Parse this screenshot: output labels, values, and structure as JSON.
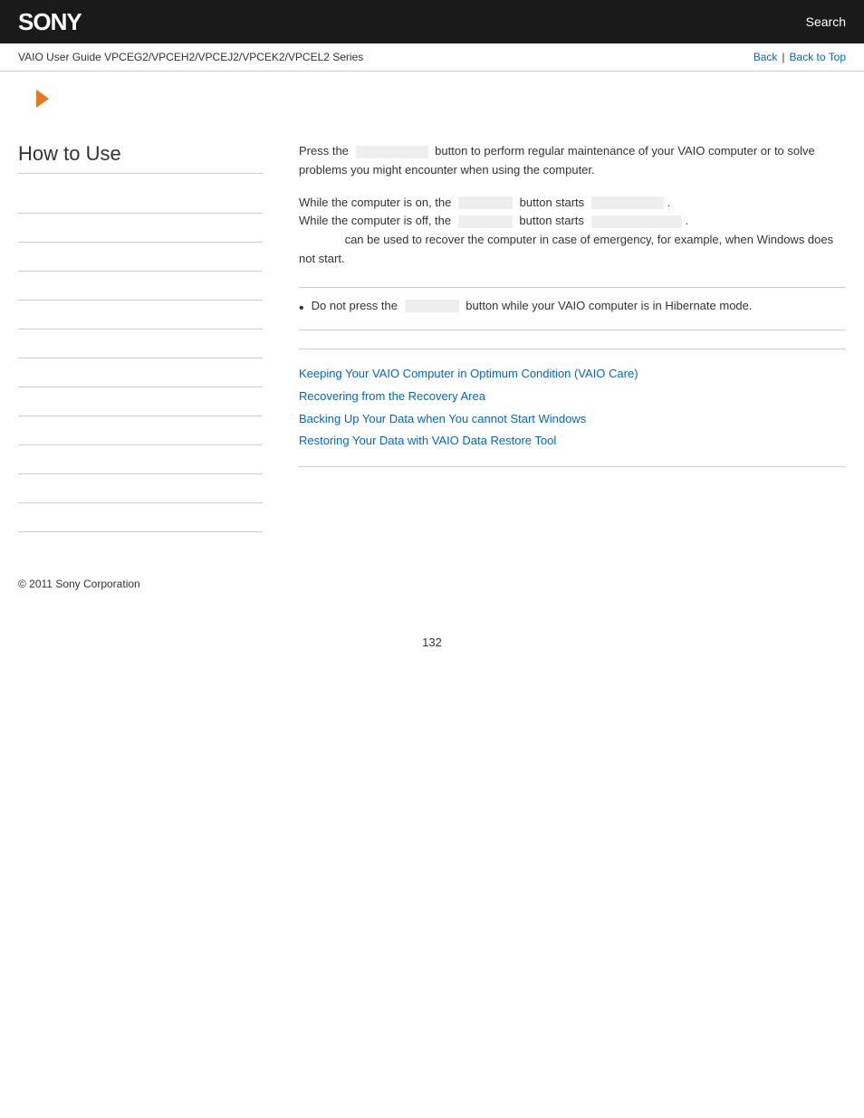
{
  "header": {
    "logo": "SONY",
    "search_label": "Search"
  },
  "nav": {
    "title": "VAIO User Guide VPCEG2/VPCEH2/VPCEJ2/VPCEK2/VPCEL2 Series",
    "back_link": "Back",
    "back_to_top_link": "Back to Top",
    "separator": "|"
  },
  "sidebar": {
    "title": "How to Use",
    "items": [
      {
        "label": ""
      },
      {
        "label": ""
      },
      {
        "label": ""
      },
      {
        "label": ""
      },
      {
        "label": ""
      },
      {
        "label": ""
      },
      {
        "label": ""
      },
      {
        "label": ""
      },
      {
        "label": ""
      },
      {
        "label": ""
      },
      {
        "label": ""
      },
      {
        "label": ""
      }
    ]
  },
  "main": {
    "paragraph1": "Press the",
    "paragraph1_mid": "button to perform regular maintenance of your VAIO computer or to solve problems you might encounter when using the computer.",
    "line2_start": "While the computer is on, the",
    "line2_mid": "button starts",
    "line3_start": "While the computer is off, the",
    "line3_mid": "button starts",
    "line4": "can be used to recover the computer in case of emergency, for example, when Windows does not start.",
    "note_label": "Do not press the",
    "note_mid": "button while your VAIO computer is in Hibernate mode.",
    "links": [
      "Keeping Your VAIO Computer in Optimum Condition (VAIO Care)",
      "Recovering from the Recovery Area",
      "Backing Up Your Data when You cannot Start Windows",
      "Restoring Your Data with VAIO Data Restore Tool"
    ]
  },
  "footer": {
    "copyright": "© 2011 Sony Corporation"
  },
  "page": {
    "number": "132"
  }
}
